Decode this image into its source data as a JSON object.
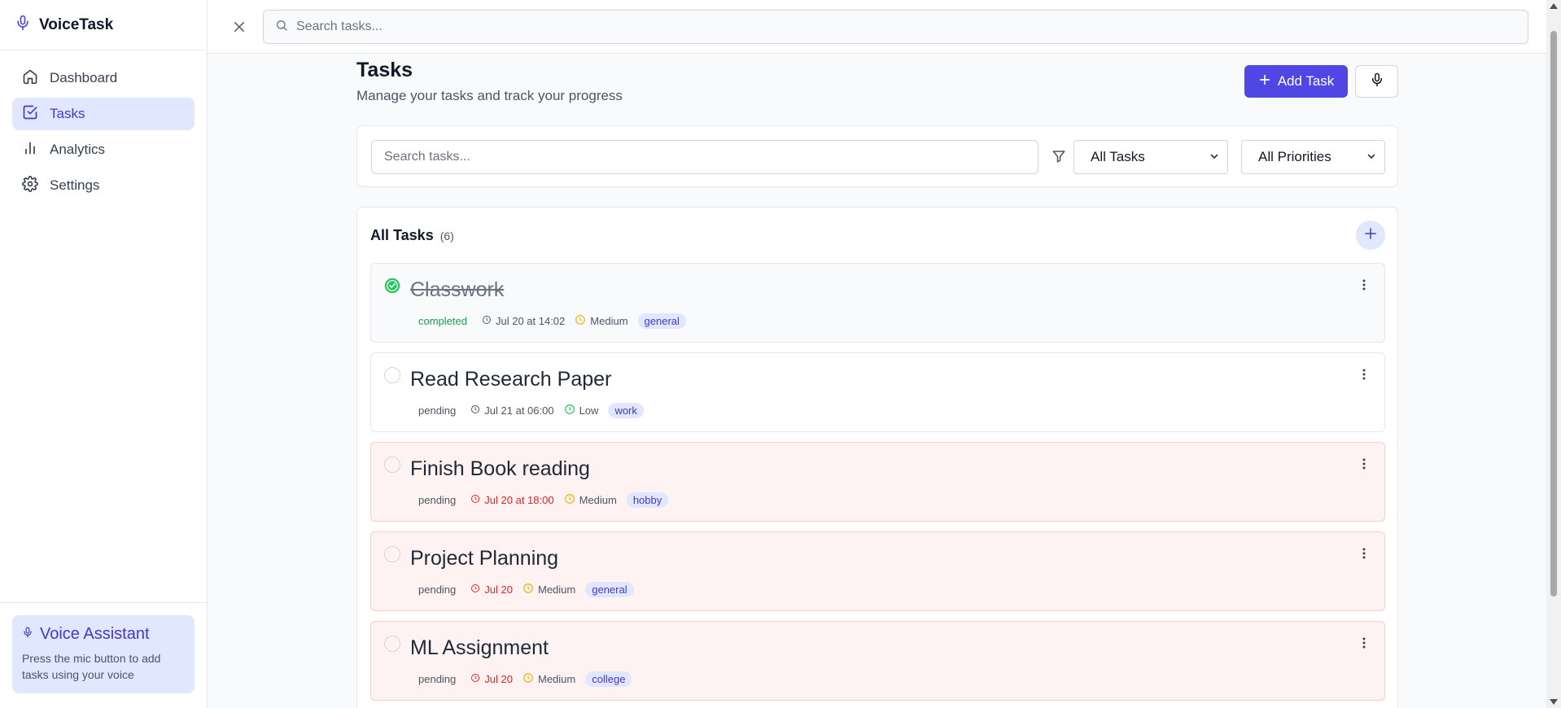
{
  "app": {
    "name": "VoiceTask",
    "brand_icon": "mic-icon",
    "accent": "#4f46e5"
  },
  "sidebar": {
    "items": [
      {
        "label": "Dashboard",
        "icon": "home-icon",
        "active": false
      },
      {
        "label": "Tasks",
        "icon": "checkbox-icon",
        "active": true
      },
      {
        "label": "Analytics",
        "icon": "bar-chart-icon",
        "active": false
      },
      {
        "label": "Settings",
        "icon": "gear-icon",
        "active": false
      }
    ],
    "voice_assistant": {
      "title": "Voice Assistant",
      "text": "Press the mic button to add tasks using your voice"
    }
  },
  "topbar": {
    "search_placeholder": "Search tasks..."
  },
  "page": {
    "title": "Tasks",
    "subtitle": "Manage your tasks and track your progress",
    "add_task_label": "Add Task"
  },
  "filters": {
    "search_placeholder": "Search tasks...",
    "status_selected": "All Tasks",
    "priority_selected": "All Priorities"
  },
  "task_list": {
    "title": "All Tasks",
    "count": "(6)",
    "tasks": [
      {
        "title": "Classwork",
        "status": "completed",
        "due": "Jul 20 at 14:02",
        "priority": "Medium",
        "tag": "general",
        "overdue": false
      },
      {
        "title": "Read Research Paper",
        "status": "pending",
        "due": "Jul 21 at 06:00",
        "priority": "Low",
        "tag": "work",
        "overdue": false
      },
      {
        "title": "Finish Book reading",
        "status": "pending",
        "due": "Jul 20 at 18:00",
        "priority": "Medium",
        "tag": "hobby",
        "overdue": true
      },
      {
        "title": "Project Planning",
        "status": "pending",
        "due": "Jul 20",
        "priority": "Medium",
        "tag": "general",
        "overdue": true
      },
      {
        "title": "ML Assignment",
        "status": "pending",
        "due": "Jul 20",
        "priority": "Medium",
        "tag": "college",
        "overdue": true
      }
    ]
  },
  "colors": {
    "priority_medium": "#eab308",
    "priority_low": "#22c55e",
    "overdue": "#dc2626",
    "completed": "#16a34a",
    "tag_bg": "#e0e7ff"
  }
}
